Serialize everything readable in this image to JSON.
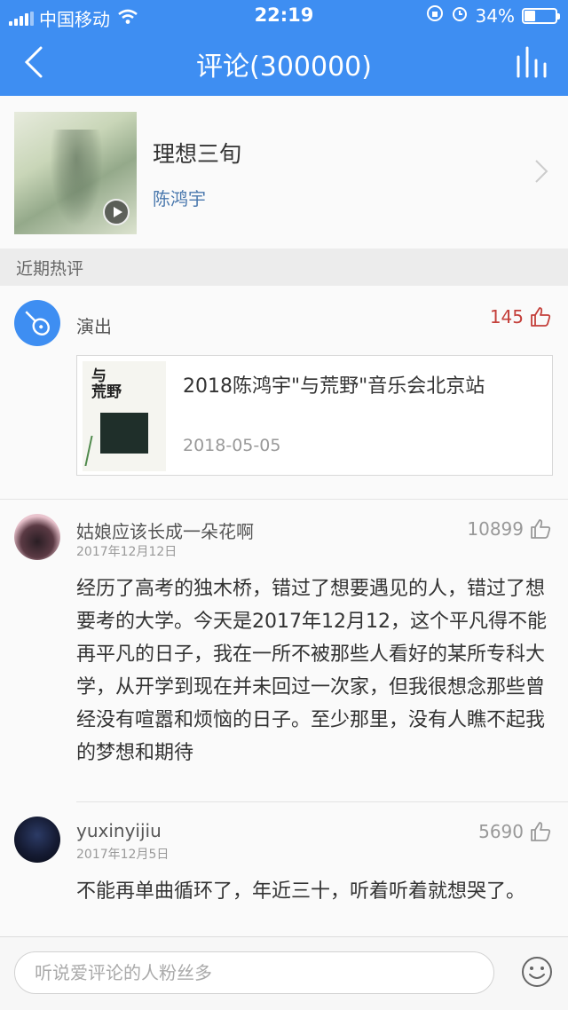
{
  "status": {
    "carrier": "中国移动",
    "time": "22:19",
    "battery": "34%",
    "battery_level": 0.34
  },
  "header": {
    "title": "评论(300000)"
  },
  "song": {
    "title": "理想三旬",
    "artist": "陈鸿宇"
  },
  "section": {
    "label": "近期热评"
  },
  "comments": [
    {
      "username": "演出",
      "likes": "145",
      "event": {
        "title": "2018陈鸿宇\"与荒野\"音乐会北京站",
        "date": "2018-05-05"
      }
    },
    {
      "username": "姑娘应该长成一朵花啊",
      "date": "2017年12月12日",
      "likes": "10899",
      "text": "经历了高考的独木桥，错过了想要遇见的人，错过了想要考的大学。今天是2017年12月12，这个平凡得不能再平凡的日子，我在一所不被那些人看好的某所专科大学，从开学到现在并未回过一次家，但我很想念那些曾经没有喧嚣和烦恼的日子。至少那里，没有人瞧不起我的梦想和期待"
    },
    {
      "username": "yuxinyijiu",
      "date": "2017年12月5日",
      "likes": "5690",
      "text": "不能再单曲循环了，年近三十，听着听着就想哭了。"
    }
  ],
  "input": {
    "placeholder": "听说爱评论的人粉丝多"
  },
  "colors": {
    "header": "#3e8ef2",
    "artist": "#4a78ad",
    "like_highlight": "#c43f3a"
  },
  "icons": {
    "back": "chevron-left-icon",
    "chart": "bar-chart-icon",
    "play": "play-icon",
    "thumb": "thumb-up-icon",
    "emoji": "smiley-icon",
    "guitar": "guitar-icon"
  }
}
